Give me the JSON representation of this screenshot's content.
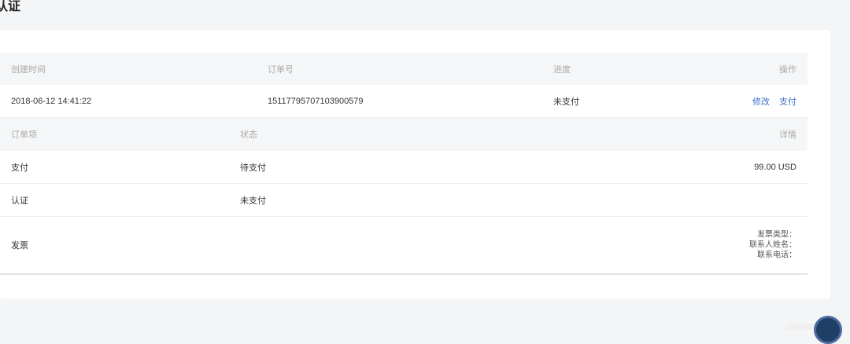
{
  "page": {
    "title": "认证"
  },
  "order_table": {
    "headers": {
      "created": "创建时间",
      "order_no": "订单号",
      "progress": "进度",
      "actions": "操作"
    },
    "row": {
      "created": "2018-06-12 14:41:22",
      "order_no": "15117795707103900579",
      "progress": "未支付",
      "edit_label": "修改",
      "pay_label": "支付"
    }
  },
  "items_table": {
    "headers": {
      "item": "订单项",
      "status": "状态",
      "detail": "详情"
    },
    "rows": [
      {
        "item": "支付",
        "status": "待支付",
        "detail": "99.00 USD"
      },
      {
        "item": "认证",
        "status": "未支付",
        "detail": ""
      },
      {
        "item": "发票",
        "status": "",
        "detail_lines": [
          "发票类型：",
          "联系人姓名：",
          "联系电话："
        ]
      }
    ]
  },
  "colors": {
    "link": "#3b73c9",
    "header_bg": "#f5f6f7"
  },
  "icons": {
    "widget": "support-chat-icon"
  }
}
